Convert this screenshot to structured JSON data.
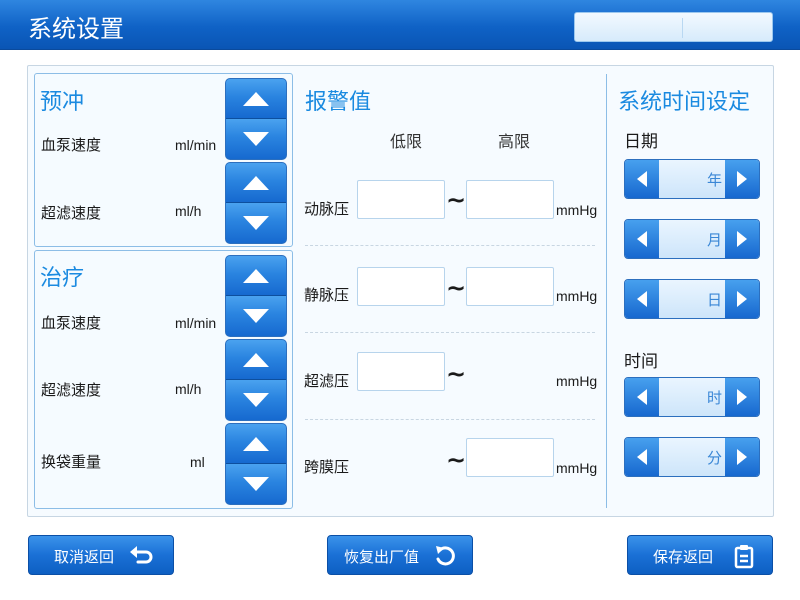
{
  "header": {
    "title": "系统设置"
  },
  "prime": {
    "title": "预冲",
    "rows": [
      {
        "label": "血泵速度",
        "unit": "ml/min"
      },
      {
        "label": "超滤速度",
        "unit": "ml/h"
      }
    ]
  },
  "treatment": {
    "title": "治疗",
    "rows": [
      {
        "label": "血泵速度",
        "unit": "ml/min"
      },
      {
        "label": "超滤速度",
        "unit": "ml/h"
      },
      {
        "label": "换袋重量",
        "unit": "ml"
      }
    ]
  },
  "alarm": {
    "title": "报警值",
    "low_label": "低限",
    "high_label": "高限",
    "rows": [
      {
        "label": "动脉压",
        "unit": "mmHg",
        "low": "",
        "high": ""
      },
      {
        "label": "静脉压",
        "unit": "mmHg",
        "low": "",
        "high": ""
      },
      {
        "label": "超滤压",
        "unit": "mmHg",
        "low": ""
      },
      {
        "label": "跨膜压",
        "unit": "mmHg",
        "high": ""
      }
    ]
  },
  "datetime": {
    "title": "系统时间设定",
    "date_label": "日期",
    "time_label": "时间",
    "year": "年",
    "month": "月",
    "day": "日",
    "hour": "时",
    "minute": "分"
  },
  "footer": {
    "cancel": "取消返回",
    "restore": "恢复出厂值",
    "save": "保存返回"
  },
  "colors": {
    "header_blue": "#0f62c6",
    "accent_title": "#1a8ae0",
    "button_blue": "#1a70d6"
  }
}
